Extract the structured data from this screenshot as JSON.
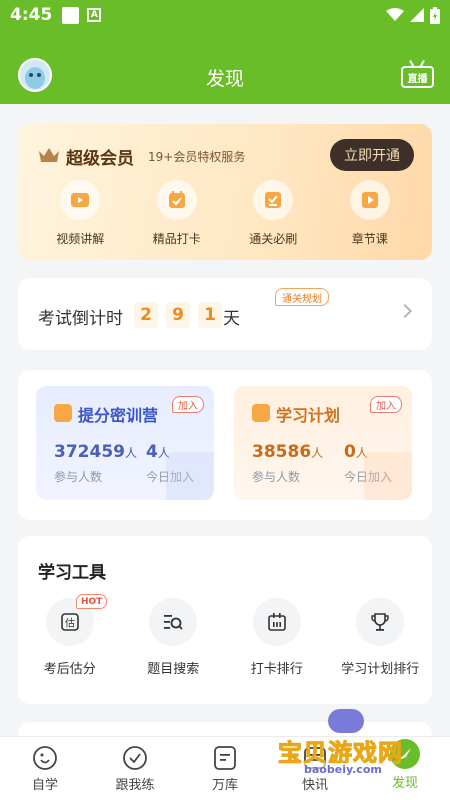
{
  "status_bar": {
    "time": "4:45",
    "notif_letter": "A"
  },
  "header": {
    "title": "发现",
    "live_label": "直播"
  },
  "vip": {
    "title": "超级会员",
    "subtitle": "19+会员特权服务",
    "open_button": "立即开通",
    "items": [
      {
        "label": "视频讲解",
        "icon": "video-icon"
      },
      {
        "label": "精品打卡",
        "icon": "checkin-icon"
      },
      {
        "label": "通关必刷",
        "icon": "checklist-icon"
      },
      {
        "label": "章节课",
        "icon": "course-icon"
      }
    ]
  },
  "countdown": {
    "label": "考试倒计时",
    "digits": [
      "2",
      "9",
      "1"
    ],
    "unit": "天",
    "tag": "通关规划"
  },
  "camps": [
    {
      "title": "提分密训营",
      "join": "加入",
      "participants": "372459",
      "participants_unit": "人",
      "today": "4",
      "today_unit": "人",
      "participants_label": "参与人数",
      "today_label": "今日加入"
    },
    {
      "title": "学习计划",
      "join": "加入",
      "participants": "38586",
      "participants_unit": "人",
      "today": "0",
      "today_unit": "人",
      "participants_label": "参与人数",
      "today_label": "今日加入"
    }
  ],
  "tools": {
    "title": "学习工具",
    "items": [
      {
        "label": "考后估分",
        "badge": "HOT",
        "icon": "estimate-icon"
      },
      {
        "label": "题目搜索",
        "icon": "search-list-icon"
      },
      {
        "label": "打卡排行",
        "icon": "calendar-icon"
      },
      {
        "label": "学习计划排行",
        "icon": "trophy-icon"
      }
    ]
  },
  "tabbar": [
    {
      "label": "自学",
      "icon": "self-study-icon"
    },
    {
      "label": "跟我练",
      "icon": "check-circle-icon"
    },
    {
      "label": "万库",
      "icon": "library-icon"
    },
    {
      "label": "快讯",
      "icon": "news-icon"
    },
    {
      "label": "发现",
      "icon": "discover-icon",
      "active": true
    }
  ],
  "watermark": {
    "name": "宝贝游戏网",
    "url": "baobeiy.com"
  },
  "colors": {
    "brand_green": "#69bd28",
    "accent_orange": "#f08a1c",
    "camp_blue": "#3a56c8"
  }
}
